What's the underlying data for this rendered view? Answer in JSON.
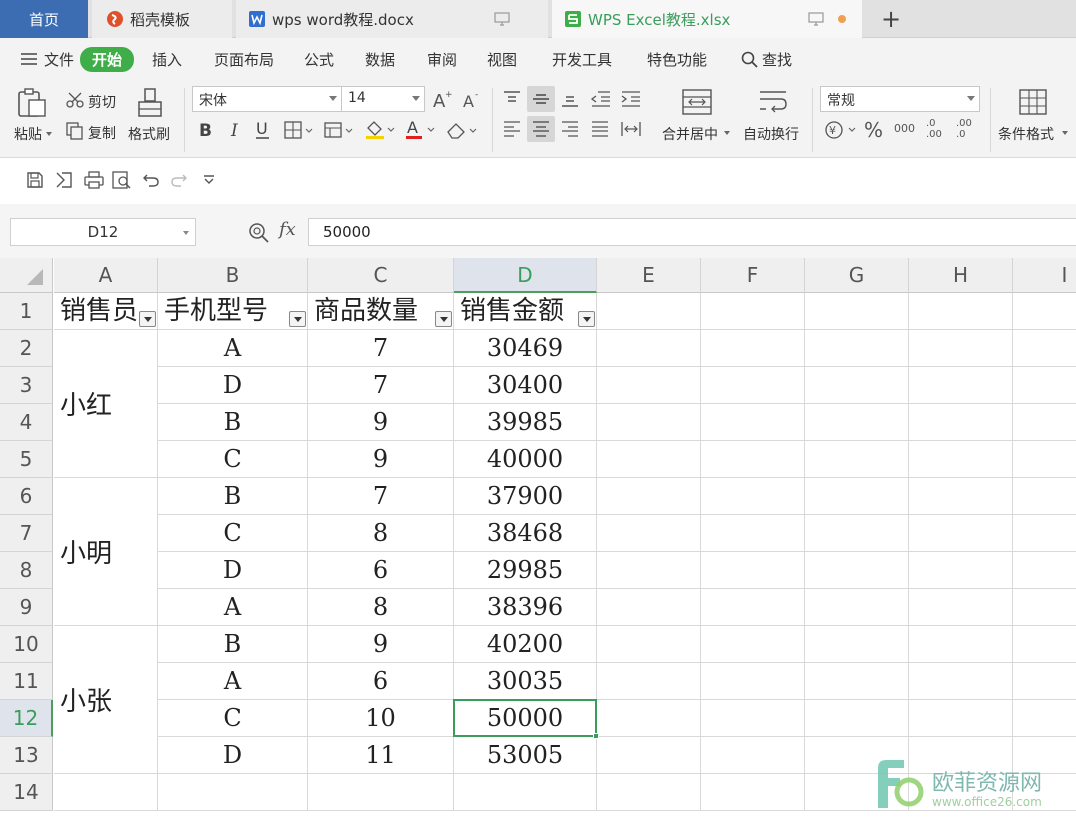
{
  "tabs": {
    "home": "首页",
    "daoke": "稻壳模板",
    "word": "wps word教程.docx",
    "excel": "WPS Excel教程.xlsx"
  },
  "menu": {
    "file": "文件",
    "start": "开始",
    "insert": "插入",
    "layout": "页面布局",
    "formula": "公式",
    "data": "数据",
    "review": "审阅",
    "view": "视图",
    "developer": "开发工具",
    "special": "特色功能",
    "search": "查找"
  },
  "ribbon": {
    "paste": "粘贴",
    "cut": "剪切",
    "copy": "复制",
    "format_painter": "格式刷",
    "font_name": "宋体",
    "font_size": "14",
    "merge_center": "合并居中",
    "wrap_text": "自动换行",
    "number_format": "常规",
    "conditional_format": "条件格式",
    "percent": "%",
    "thousands": "000",
    "inc_decimal": ".0\n.00",
    "dec_decimal": ".00\n.0"
  },
  "formula_bar": {
    "name_box": "D12",
    "fx": "fx",
    "value": "50000"
  },
  "columns": [
    "A",
    "B",
    "C",
    "D",
    "E",
    "F",
    "G",
    "H",
    "I"
  ],
  "rows": [
    "1",
    "2",
    "3",
    "4",
    "5",
    "6",
    "7",
    "8",
    "9",
    "10",
    "11",
    "12",
    "13",
    "14"
  ],
  "table": {
    "headers": [
      "销售员",
      "手机型号",
      "商品数量",
      "销售金额"
    ],
    "groups": [
      {
        "name": "小红",
        "rows": [
          [
            "A",
            "7",
            "30469"
          ],
          [
            "D",
            "7",
            "30400"
          ],
          [
            "B",
            "9",
            "39985"
          ],
          [
            "C",
            "9",
            "40000"
          ]
        ]
      },
      {
        "name": "小明",
        "rows": [
          [
            "B",
            "7",
            "37900"
          ],
          [
            "C",
            "8",
            "38468"
          ],
          [
            "D",
            "6",
            "29985"
          ],
          [
            "A",
            "8",
            "38396"
          ]
        ]
      },
      {
        "name": "小张",
        "rows": [
          [
            "B",
            "9",
            "40200"
          ],
          [
            "A",
            "6",
            "30035"
          ],
          [
            "C",
            "10",
            "50000"
          ],
          [
            "D",
            "11",
            "53005"
          ]
        ]
      }
    ]
  },
  "selection": {
    "column": "D",
    "row": "12"
  },
  "watermark": {
    "cn": "欧菲资源网",
    "url": "www.office26.com"
  },
  "colors": {
    "accent_green": "#3fae49",
    "home_tab": "#3c6db2",
    "wps_red": "#e0512b",
    "word_blue": "#2f6fd0"
  }
}
